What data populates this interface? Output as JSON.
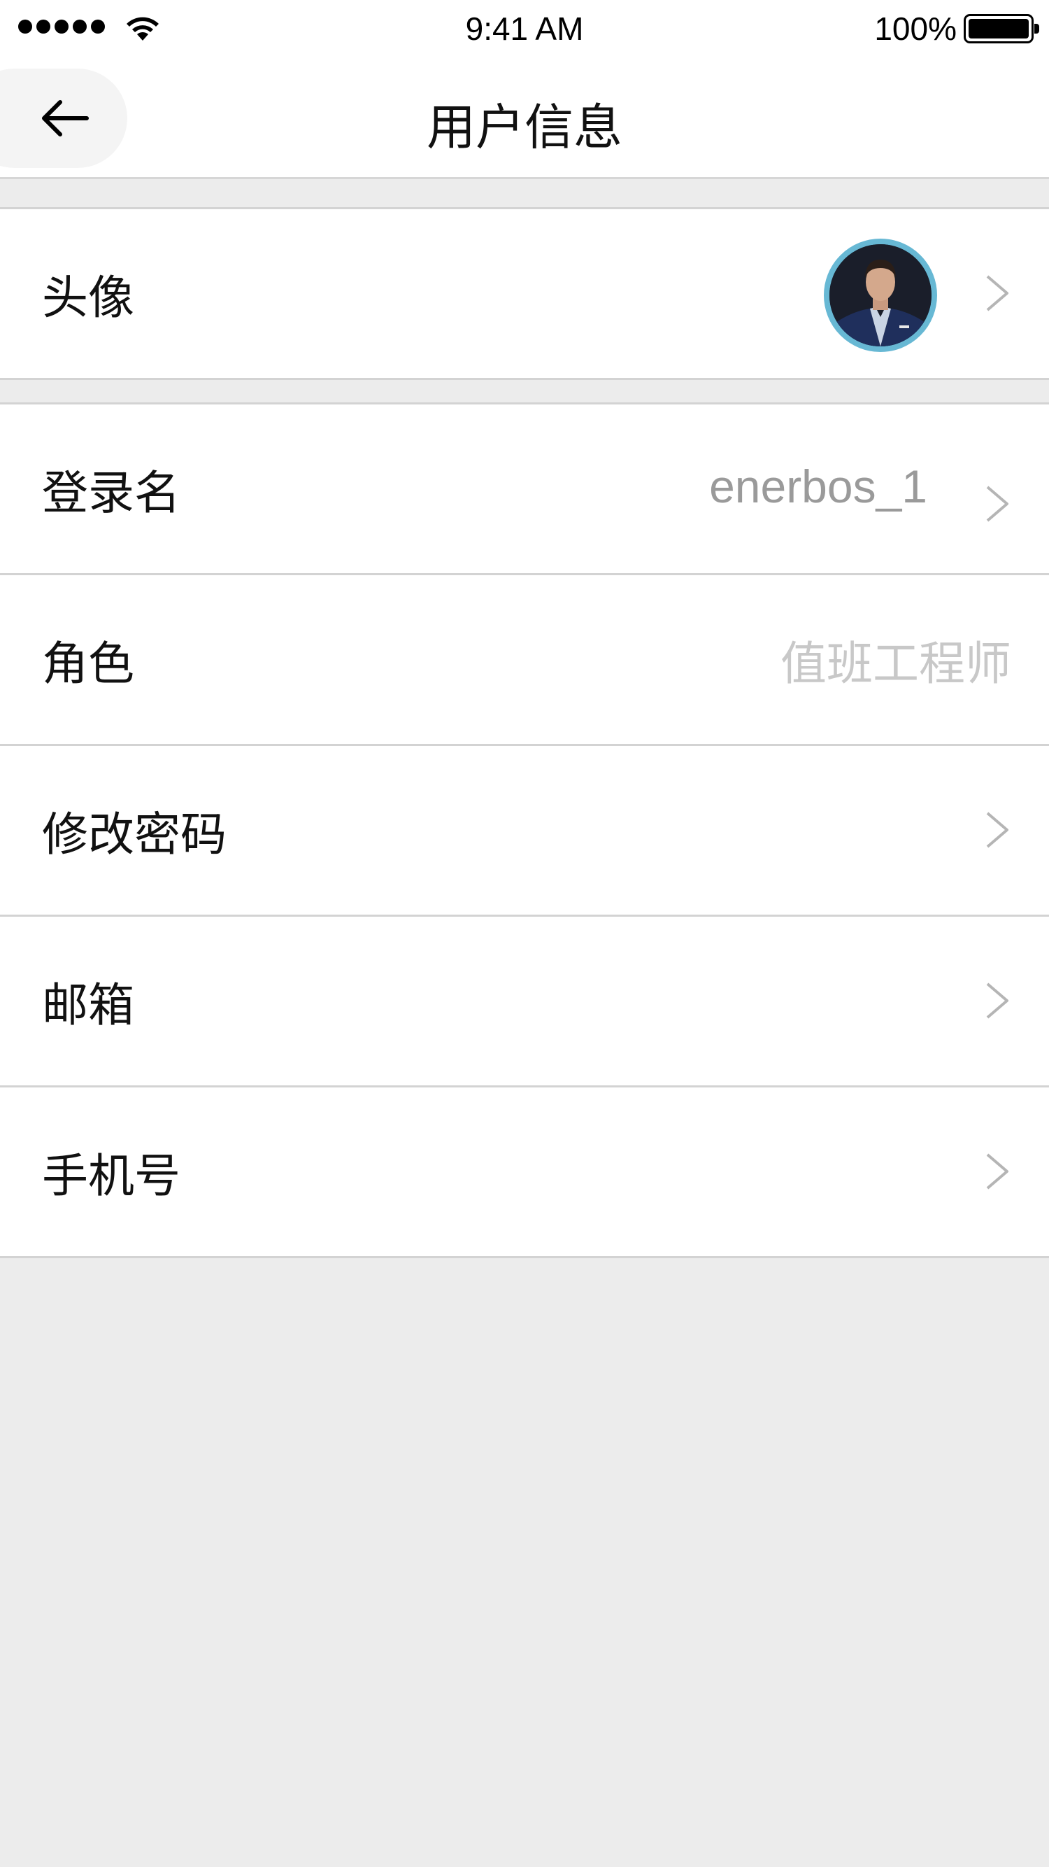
{
  "status_bar": {
    "time": "9:41 AM",
    "battery_percent": "100%",
    "signal_bars": 5,
    "icons": [
      "signal-icon",
      "wifi-icon",
      "battery-icon"
    ]
  },
  "nav": {
    "title": "用户信息",
    "back_icon": "arrow-left-icon"
  },
  "rows": {
    "avatar": {
      "label": "头像",
      "icon": "avatar-photo"
    },
    "login_name": {
      "label": "登录名",
      "value": "enerbos_1"
    },
    "role": {
      "label": "角色",
      "value": "值班工程师"
    },
    "change_password": {
      "label": "修改密码"
    },
    "email": {
      "label": "邮箱"
    },
    "phone": {
      "label": "手机号"
    }
  },
  "colors": {
    "background": "#ececec",
    "surface": "#ffffff",
    "divider": "#d3d3d3",
    "avatar_ring": "#67b8d4",
    "value_text": "#9a9a9a",
    "chevron": "#b5b5b5"
  }
}
